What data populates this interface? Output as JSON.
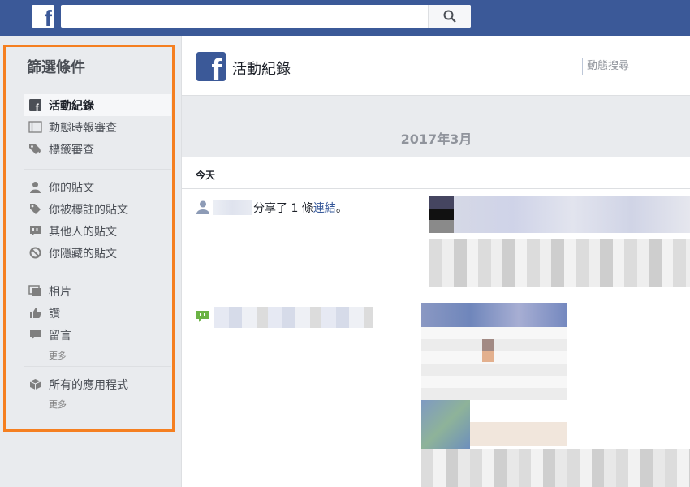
{
  "topbar": {
    "logo": "f",
    "search_icon": "search-icon"
  },
  "sidebar": {
    "title": "篩選條件",
    "group1": [
      {
        "label": "活動紀錄",
        "icon": "facebook-icon",
        "active": true
      },
      {
        "label": "動態時報審查",
        "icon": "timeline-icon"
      },
      {
        "label": "標籤審查",
        "icon": "tag-review-icon"
      }
    ],
    "group2": [
      {
        "label": "你的貼文",
        "icon": "person-icon"
      },
      {
        "label": "你被標註的貼文",
        "icon": "tag-icon"
      },
      {
        "label": "其他人的貼文",
        "icon": "quote-icon"
      },
      {
        "label": "你隱藏的貼文",
        "icon": "hidden-icon"
      }
    ],
    "group3": [
      {
        "label": "相片",
        "icon": "photos-icon"
      },
      {
        "label": "讚",
        "icon": "like-icon"
      },
      {
        "label": "留言",
        "icon": "comment-icon"
      }
    ],
    "more1": "更多",
    "group4": [
      {
        "label": "所有的應用程式",
        "icon": "apps-cube-icon"
      }
    ],
    "more2": "更多"
  },
  "main": {
    "title": "活動紀錄",
    "search_placeholder": "動態搜尋",
    "month": "2017年3月",
    "day": "今天",
    "entry1": {
      "text_before": "分享了 1 條",
      "link": "連結",
      "text_after": "。"
    }
  },
  "colors": {
    "brand": "#3b5998",
    "highlight_border": "#f57f20",
    "link": "#365899"
  }
}
